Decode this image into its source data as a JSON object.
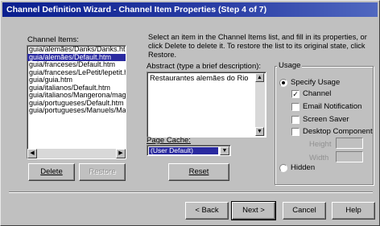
{
  "window": {
    "title": "Channel Definition Wizard - Channel Item Properties (Step 4 of 7)"
  },
  "channel_items": {
    "label": "Channel Items:",
    "items": [
      "guia/alemães/Danks/Danks.ht",
      "guia/alemães/Default.htm",
      "guia/franceses/Default.htm",
      "guia/franceses/LePetit/lepetit.h",
      "guia/guia.htm",
      "guia/italianos/Default.htm",
      "guia/italianos/Mangerona/mag",
      "guia/portugueses/Default.htm",
      "guia/portugueses/Manuels/Ma"
    ],
    "selected_index": 1,
    "delete_label": "Delete",
    "restore_label": "Restore"
  },
  "instructions": "Select an item in the Channel Items list, and fill in its properties, or click Delete to delete it.  To restore the list to its original state, click Restore.",
  "abstract": {
    "label": "Abstract (type a brief description):",
    "value": "Restaurantes alemães do Rio"
  },
  "page_cache": {
    "label": "Page Cache:",
    "value": "(User Default)"
  },
  "reset_label": "Reset",
  "usage": {
    "title": "Usage",
    "specify_usage": "Specify Usage",
    "specify_selected": true,
    "options": [
      {
        "label": "Channel",
        "checked": true
      },
      {
        "label": "Email Notification",
        "checked": false
      },
      {
        "label": "Screen Saver",
        "checked": false
      },
      {
        "label": "Desktop Component",
        "checked": false
      }
    ],
    "height_label": "Height",
    "width_label": "Width",
    "hidden": "Hidden",
    "hidden_selected": false
  },
  "footer": {
    "back_label": "< Back",
    "next_label": "Next >",
    "cancel_label": "Cancel",
    "help_label": "Help"
  }
}
